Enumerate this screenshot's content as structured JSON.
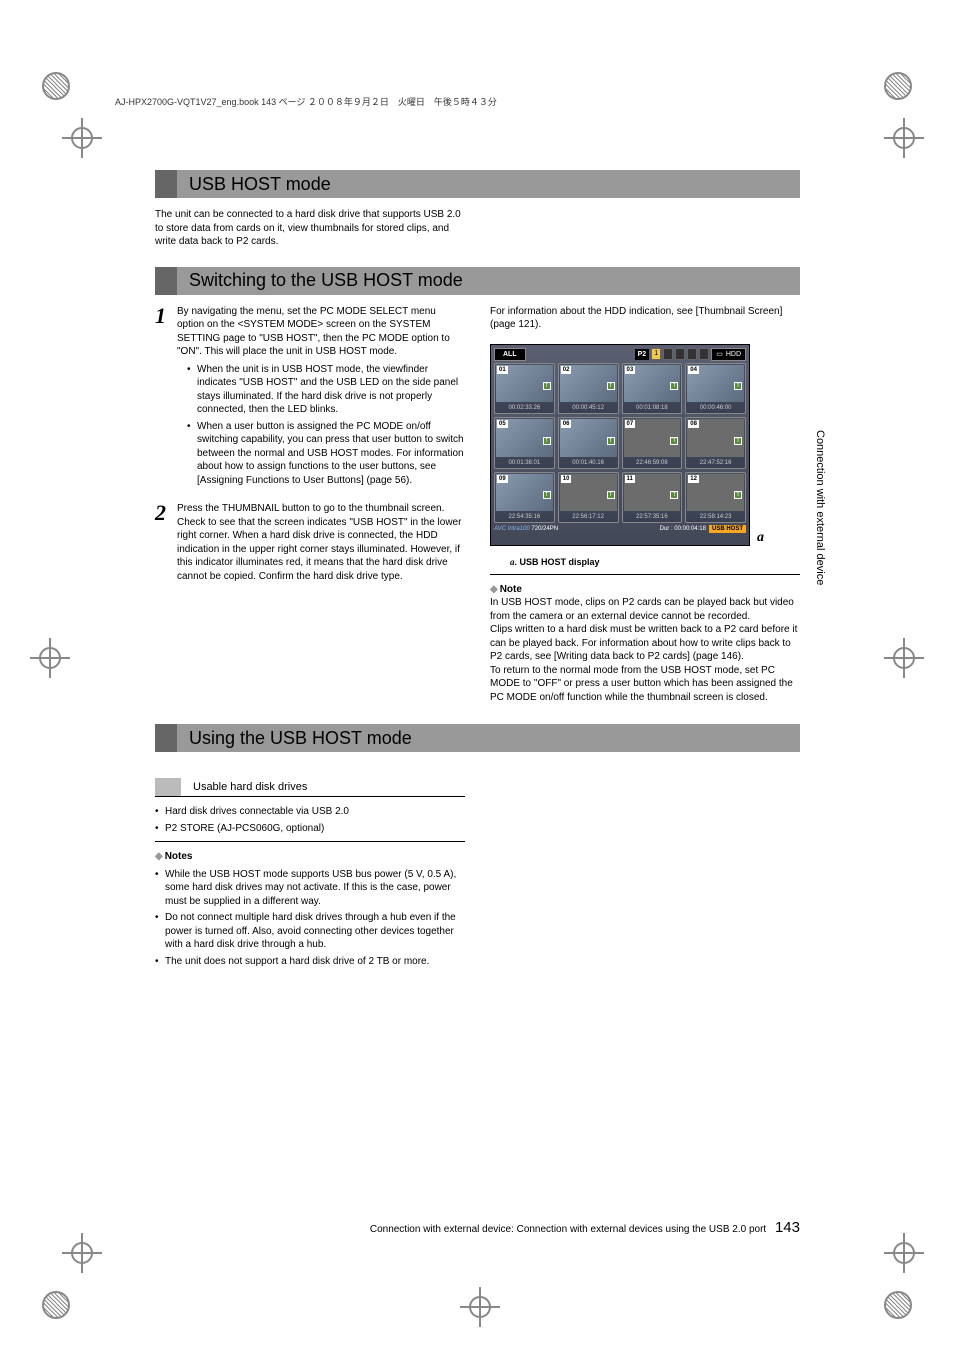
{
  "header_line": "AJ-HPX2700G-VQT1V27_eng.book  143 ページ  ２００８年９月２日　火曜日　午後５時４３分",
  "side_text": "Connection with external device",
  "section1": {
    "title": "USB HOST mode",
    "intro": "The unit can be connected to a hard disk drive that supports USB 2.0 to store data from cards on it, view thumbnails for stored clips, and write data back to P2 cards."
  },
  "section2": {
    "title": "Switching to the USB HOST mode",
    "step1": {
      "text": "By navigating the menu, set the PC MODE SELECT menu option on the <SYSTEM MODE> screen on the SYSTEM SETTING page to \"USB HOST\", then the PC MODE option to \"ON\". This will place the unit in USB HOST mode.",
      "bullets": [
        "When the unit is in USB HOST mode, the viewfinder indicates \"USB HOST\" and the USB LED on the side panel stays illuminated. If the hard disk drive is not properly connected, then the LED blinks.",
        "When a user button is assigned the PC MODE on/off switching capability, you can press that user button to switch between the normal and USB HOST modes. For information about how to assign functions to the user buttons, see [Assigning Functions to User Buttons] (page 56)."
      ]
    },
    "step2": "Press the THUMBNAIL button to go to the thumbnail screen. Check to see that the screen indicates \"USB HOST\" in the lower right corner. When a hard disk drive is connected, the HDD indication in the upper right corner stays illuminated. However, if this indicator illuminates red, it means that the hard disk drive cannot be copied. Confirm the hard disk drive type.",
    "right_intro": "For information about the HDD indication, see [Thumbnail Screen] (page 121).",
    "thumbnails": {
      "all": "ALL",
      "p2": "P2",
      "slot": "1",
      "hdd": "HDD",
      "cells": [
        {
          "n": "01",
          "t": "00:02:33.26"
        },
        {
          "n": "02",
          "t": "00:00:45:12"
        },
        {
          "n": "03",
          "t": "00:01:08:18"
        },
        {
          "n": "04",
          "t": "00:00:46:00"
        },
        {
          "n": "05",
          "t": "00:01:38.01"
        },
        {
          "n": "06",
          "t": "00:01:40.16"
        },
        {
          "n": "07",
          "t": "22:46:59:08"
        },
        {
          "n": "08",
          "t": "22:47:52:16"
        },
        {
          "n": "09",
          "t": "22:54:35:16"
        },
        {
          "n": "10",
          "t": "22:56:17:12"
        },
        {
          "n": "11",
          "t": "22:57:35:16"
        },
        {
          "n": "12",
          "t": "22:58:14:23"
        }
      ],
      "bottom_left": "720/24PN",
      "bottom_right_dur": "Dur : 00:00:04:18",
      "usb_host": "USB HOST"
    },
    "caption_a": "a",
    "caption": "USB HOST display",
    "note_label": "Note",
    "note_text": [
      "In USB HOST mode, clips on P2 cards can be played back but video from the camera or an external device cannot be recorded.",
      "Clips written to a hard disk must be written back to a P2 card before it can be played back. For information about how to write clips back to P2 cards, see [Writing data back to P2 cards] (page 146).",
      "To return to the normal mode from the USB HOST mode, set PC MODE to \"OFF\" or press a user button which has been assigned the PC MODE on/off function while the thumbnail screen is closed."
    ]
  },
  "section3": {
    "title": "Using the USB HOST mode",
    "sub": "Usable hard disk drives",
    "bullets": [
      "Hard disk drives connectable via USB 2.0",
      "P2 STORE (AJ-PCS060G, optional)"
    ],
    "notes_label": "Notes",
    "notes": [
      "While the USB HOST mode supports USB bus power (5 V, 0.5 A), some hard disk drives may not activate. If this is the case, power must be supplied in a different way.",
      "Do not connect multiple hard disk drives through a hub even if the power is turned off. Also, avoid connecting other devices together with a hard disk drive through a hub.",
      "The unit does not support a hard disk drive of 2 TB or more."
    ]
  },
  "footer": {
    "text": "Connection with external device: Connection with external devices using the USB 2.0 port",
    "page": "143"
  }
}
